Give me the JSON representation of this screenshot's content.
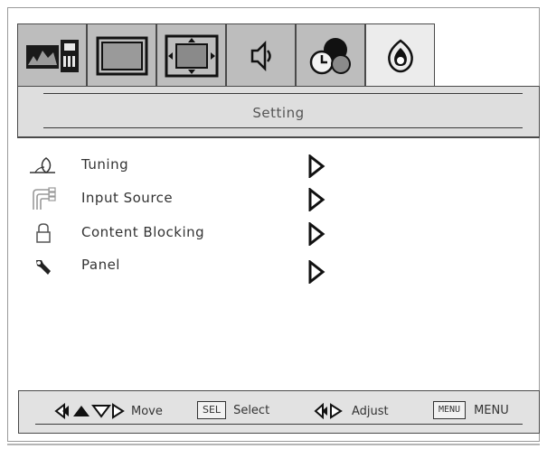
{
  "tabs": [
    {
      "name": "picture-tab",
      "icon": "picture-icon",
      "active": false
    },
    {
      "name": "screen-tab",
      "icon": "screen-icon",
      "active": false
    },
    {
      "name": "display-tab",
      "icon": "display-adjust-icon",
      "active": false
    },
    {
      "name": "audio-tab",
      "icon": "speaker-icon",
      "active": false
    },
    {
      "name": "time-tab",
      "icon": "clock-icon",
      "active": false
    },
    {
      "name": "setting-tab",
      "icon": "setting-icon",
      "active": true
    }
  ],
  "header": {
    "title": "Setting"
  },
  "menu": {
    "items": [
      {
        "label": "Tuning",
        "icon": "antenna-icon"
      },
      {
        "label": "Input Source",
        "icon": "input-cable-icon"
      },
      {
        "label": "Content Blocking",
        "icon": "lock-icon"
      },
      {
        "label": "Panel",
        "icon": "wrench-icon"
      }
    ]
  },
  "footer": {
    "move_label": "Move",
    "select_key": "SEL",
    "select_label": "Select",
    "adjust_label": "Adjust",
    "menu_key": "MENU",
    "menu_label": "MENU"
  },
  "colors": {
    "tab_inactive": "#bdbdbd",
    "tab_active": "#ececec",
    "header_band": "#dedede",
    "border": "#4a4a4a",
    "text": "#333333"
  }
}
